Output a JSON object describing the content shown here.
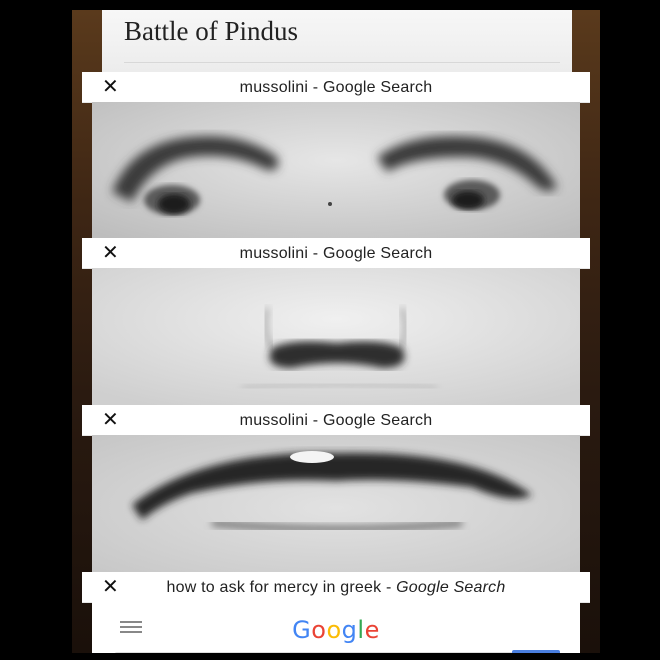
{
  "back_page": {
    "title": "Battle of Pindus"
  },
  "tabs": [
    {
      "close": "✕",
      "title_main": "mussolini - Google Search",
      "content": "eyes"
    },
    {
      "close": "✕",
      "title_main": "mussolini - Google Search",
      "content": "nose"
    },
    {
      "close": "✕",
      "title_main": "mussolini - Google Search",
      "content": "mouth"
    },
    {
      "close": "✕",
      "title_main": "how to ask for mercy in greek - ",
      "title_italic": "Google Search",
      "content": "google-search-page"
    }
  ],
  "google": {
    "logo_letters": [
      "G",
      "o",
      "o",
      "g",
      "l",
      "e"
    ],
    "logo_colors": [
      "#4285F4",
      "#EA4335",
      "#FBBC05",
      "#4285F4",
      "#34A853",
      "#EA4335"
    ]
  }
}
